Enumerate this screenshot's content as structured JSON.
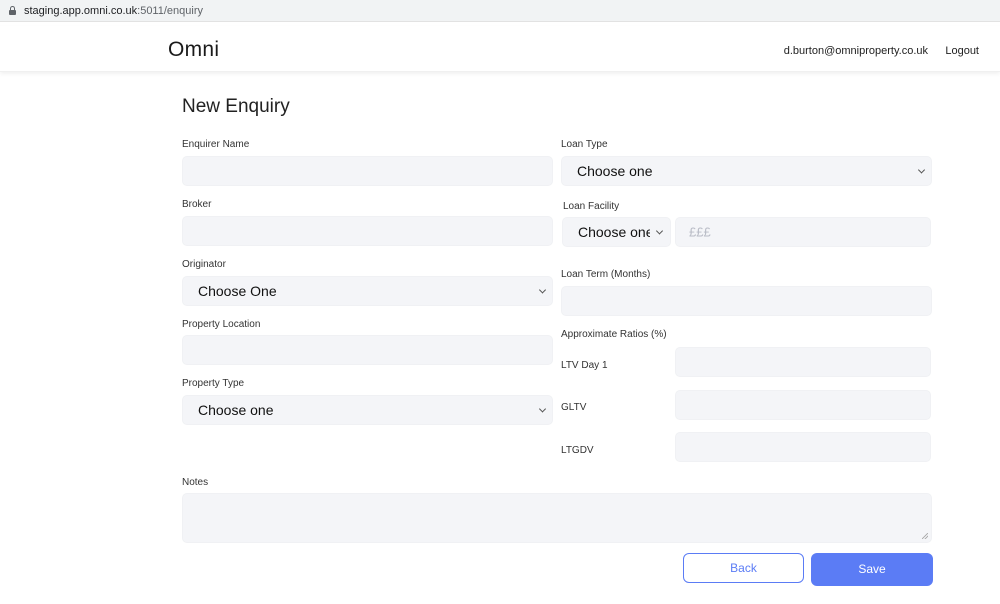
{
  "browser": {
    "url_host": "staging.app.omni.co.uk",
    "url_path": ":5011/enquiry"
  },
  "header": {
    "brand": "Omni",
    "user_email": "d.burton@omniproperty.co.uk",
    "logout_label": "Logout"
  },
  "page": {
    "title": "New Enquiry"
  },
  "form": {
    "enquirer_name": {
      "label": "Enquirer Name",
      "value": ""
    },
    "broker": {
      "label": "Broker",
      "value": ""
    },
    "originator": {
      "label": "Originator",
      "selected": "Choose One"
    },
    "property_location": {
      "label": "Property Location",
      "value": ""
    },
    "property_type": {
      "label": "Property Type",
      "selected": "Choose one"
    },
    "loan_type": {
      "label": "Loan Type",
      "selected": "Choose one"
    },
    "loan_facility": {
      "label": "Loan Facility",
      "selected": "Choose one",
      "amount_placeholder": "£££"
    },
    "loan_term": {
      "label": "Loan Term (Months)",
      "value": ""
    },
    "ratios": {
      "label": "Approximate Ratios (%)",
      "ltv_day1_label": "LTV Day 1",
      "gltv_label": "GLTV",
      "ltgdv_label": "LTGDV"
    },
    "notes": {
      "label": "Notes",
      "value": ""
    }
  },
  "actions": {
    "back_label": "Back",
    "save_label": "Save"
  },
  "colors": {
    "accent": "#5b7cf5",
    "field_bg": "#f4f5f8"
  },
  "icons": [
    "lock-icon",
    "chevron-down-icon",
    "resize-grip-icon"
  ]
}
